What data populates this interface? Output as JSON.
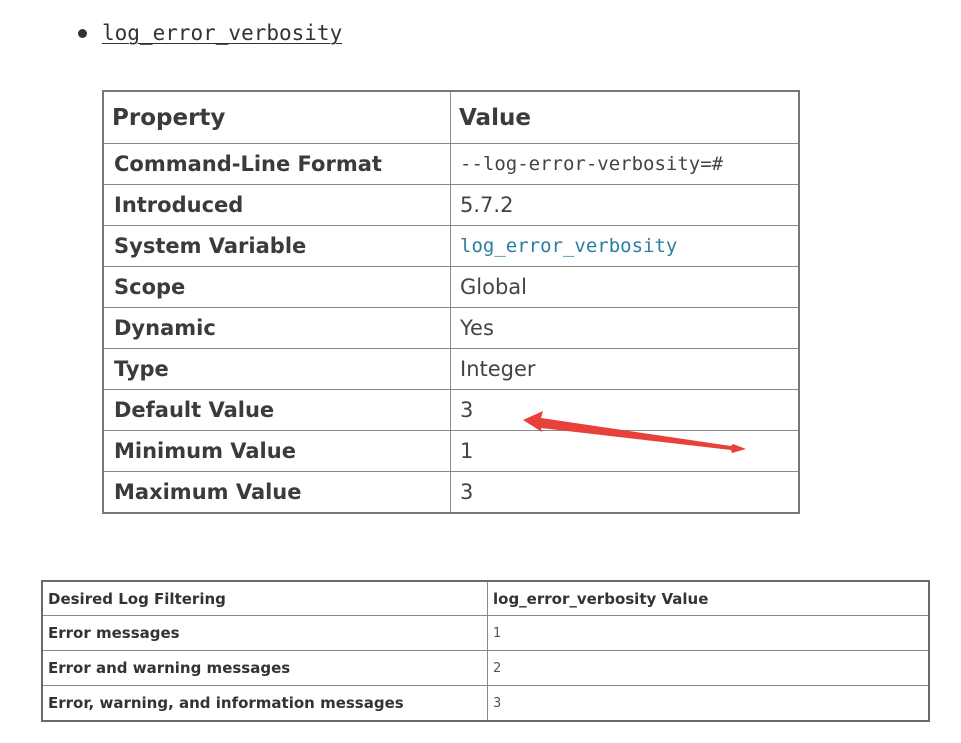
{
  "option": {
    "name": "log_error_verbosity"
  },
  "property_table": {
    "headers": [
      "Property",
      "Value"
    ],
    "rows": [
      {
        "property": "Command-Line Format",
        "value": "--log-error-verbosity=#"
      },
      {
        "property": "Introduced",
        "value": "5.7.2"
      },
      {
        "property": "System Variable",
        "value": "log_error_verbosity"
      },
      {
        "property": "Scope",
        "value": "Global"
      },
      {
        "property": "Dynamic",
        "value": "Yes"
      },
      {
        "property": "Type",
        "value": "Integer"
      },
      {
        "property": "Default Value",
        "value": "3"
      },
      {
        "property": "Minimum Value",
        "value": "1"
      },
      {
        "property": "Maximum Value",
        "value": "3"
      }
    ]
  },
  "filter_table": {
    "headers": [
      "Desired Log Filtering",
      "log_error_verbosity Value"
    ],
    "rows": [
      {
        "filtering": "Error messages",
        "value": "1"
      },
      {
        "filtering": "Error and warning messages",
        "value": "2"
      },
      {
        "filtering": "Error, warning, and information messages",
        "value": "3"
      }
    ]
  },
  "annotation": {
    "arrow_color": "#e8403a"
  },
  "colors": {
    "link": "#2c7ea0",
    "text": "#333333",
    "border": "#8a8a8a"
  }
}
